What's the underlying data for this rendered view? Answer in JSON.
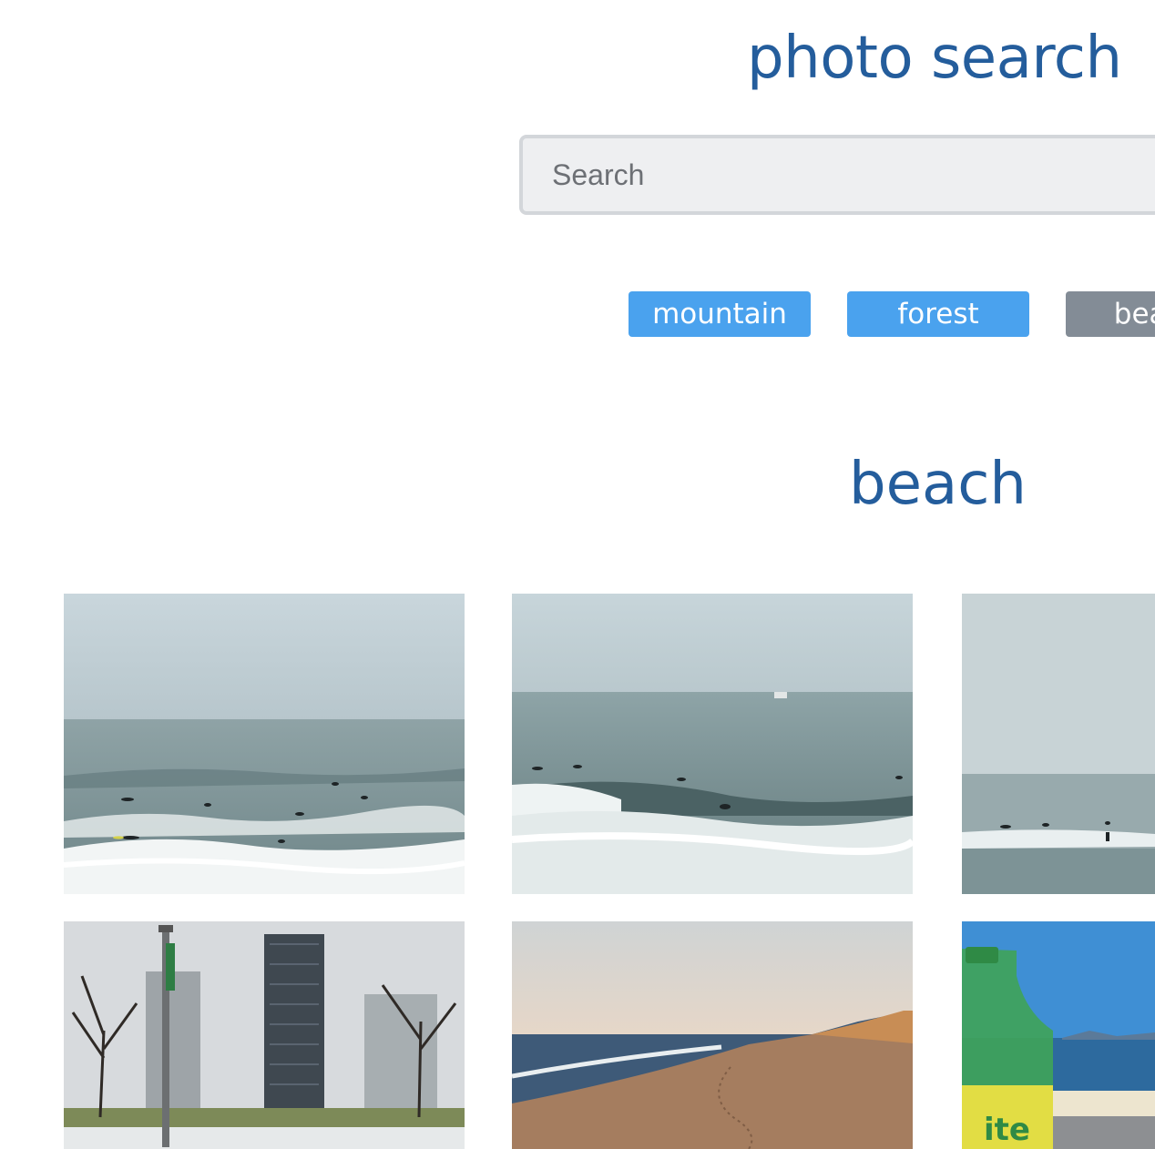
{
  "header": {
    "title": "photo search"
  },
  "search": {
    "placeholder": "Search",
    "value": ""
  },
  "tags": [
    {
      "label": "mountain",
      "active": false
    },
    {
      "label": "forest",
      "active": false
    },
    {
      "label": "beach",
      "active": true
    }
  ],
  "gallery": {
    "title": "beach",
    "photos": [
      {
        "subject": "surfers-waves"
      },
      {
        "subject": "surfers-breaking-wave"
      },
      {
        "subject": "surfers-calm-sea"
      },
      {
        "subject": "city-park-towers"
      },
      {
        "subject": "sandy-beach-footprints"
      },
      {
        "subject": "soda-bottle-sea"
      }
    ]
  },
  "colors": {
    "title": "#245d9c",
    "tag_inactive": "#4aa2ee",
    "tag_active": "#838c96",
    "search_bg": "#eeeff1"
  }
}
